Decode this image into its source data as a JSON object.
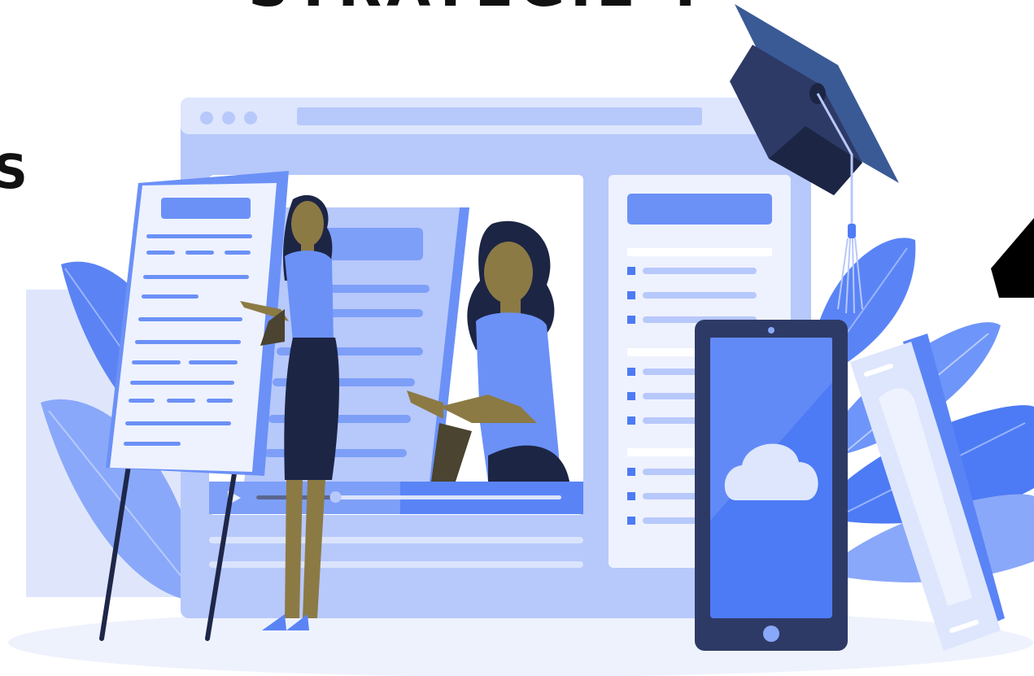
{
  "heading": {
    "title_fragment": "STRATEGIE Y",
    "left_edge_fragment": "S"
  },
  "icons": {
    "cap": "graduation-cap-icon",
    "cloud": "cloud-icon",
    "play": "play-icon",
    "dots": "window-dots-icon"
  },
  "video": {
    "progress_fraction": 0.26
  },
  "colors": {
    "window_bg": "#b7c8fb",
    "accent_blue": "#5a84f6",
    "navy": "#2e3a66",
    "skin": "#8c7a45",
    "leaf": "#6e95f9",
    "ground": "#eef2fd"
  }
}
